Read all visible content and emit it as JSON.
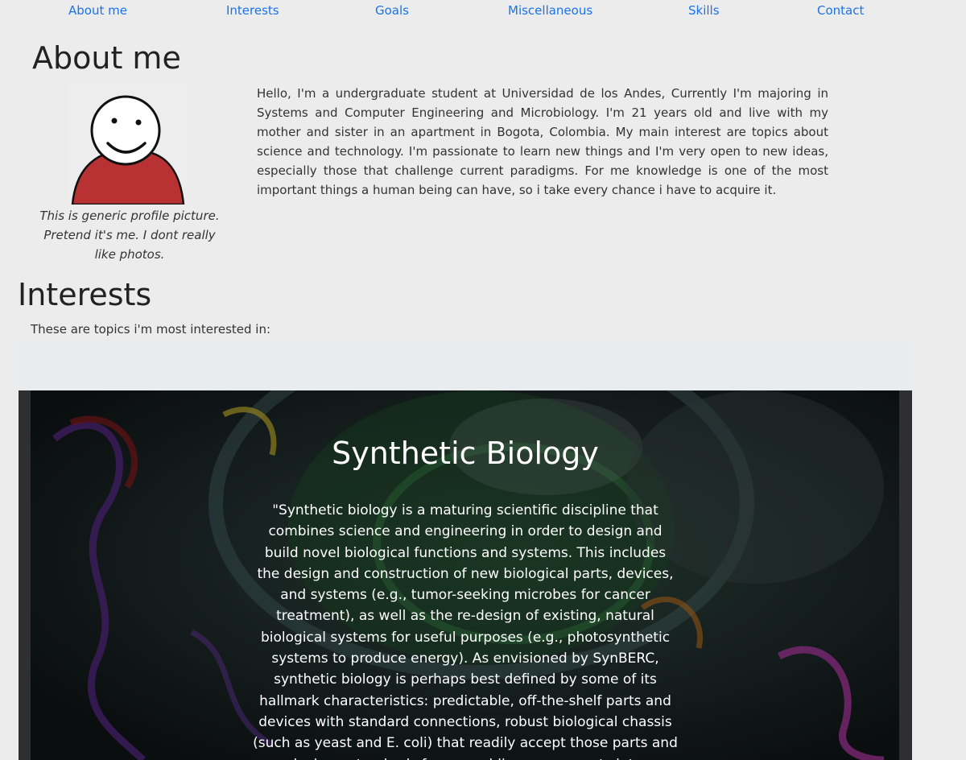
{
  "nav": {
    "about": "About me",
    "interests": "Interests",
    "goals": "Goals",
    "misc": "Miscellaneous",
    "skills": "Skills",
    "contact": "Contact"
  },
  "about": {
    "title": "About me",
    "avatar_icon": "profile-doodle-icon",
    "caption": "This is generic profile picture. Pretend it's me. I dont really like photos.",
    "text": "Hello, I'm a undergraduate student at Universidad de los Andes, Currently I'm majoring in Systems and Computer Engineering and Microbiology. I'm 21 years old and live with my mother and sister in an apartment in Bogota, Colombia. My main interest are topics about science and technology. I'm passionate to learn new things and I'm very open to new ideas, especially those that challenge current paradigms. For me knowledge is one of the most important things a human being can have, so i take every chance i have to acquire it."
  },
  "interests": {
    "title": "Interests",
    "subtitle": "These are topics i'm most interested in:",
    "slide": {
      "title": "Synthetic Biology",
      "text": "\"Synthetic biology is a maturing scientific discipline that combines science and engineering in order to design and build novel biological functions and systems. This includes the design and construction of new biological parts, devices, and systems (e.g., tumor-seeking microbes for cancer treatment), as well as the re-design of existing, natural biological systems for useful purposes (e.g., photosynthetic systems to produce energy). As envisioned by SynBERC, synthetic biology is perhaps best defined by some of its hallmark characteristics: predictable, off-the-shelf parts and devices with standard connections, robust biological chassis (such as yeast and E. coli) that readily accept those parts and devices, standards for assembling components into increasingly sophisticated and"
    }
  },
  "colors": {
    "link": "#1a73e8",
    "page_bg": "#ececec",
    "avatar_shirt": "#b83234"
  }
}
